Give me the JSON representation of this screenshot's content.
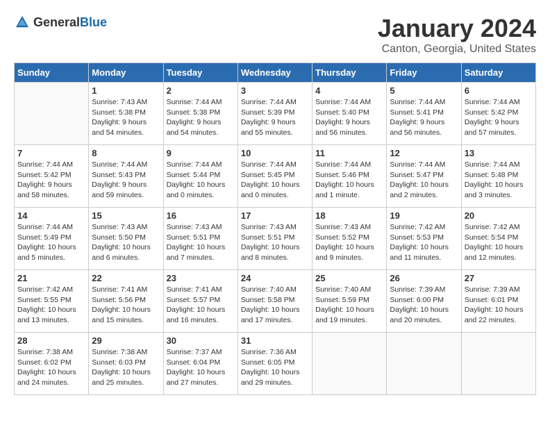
{
  "header": {
    "logo_general": "General",
    "logo_blue": "Blue",
    "month": "January 2024",
    "location": "Canton, Georgia, United States"
  },
  "weekdays": [
    "Sunday",
    "Monday",
    "Tuesday",
    "Wednesday",
    "Thursday",
    "Friday",
    "Saturday"
  ],
  "weeks": [
    [
      {
        "day": "",
        "info": ""
      },
      {
        "day": "1",
        "info": "Sunrise: 7:43 AM\nSunset: 5:38 PM\nDaylight: 9 hours\nand 54 minutes."
      },
      {
        "day": "2",
        "info": "Sunrise: 7:44 AM\nSunset: 5:38 PM\nDaylight: 9 hours\nand 54 minutes."
      },
      {
        "day": "3",
        "info": "Sunrise: 7:44 AM\nSunset: 5:39 PM\nDaylight: 9 hours\nand 55 minutes."
      },
      {
        "day": "4",
        "info": "Sunrise: 7:44 AM\nSunset: 5:40 PM\nDaylight: 9 hours\nand 56 minutes."
      },
      {
        "day": "5",
        "info": "Sunrise: 7:44 AM\nSunset: 5:41 PM\nDaylight: 9 hours\nand 56 minutes."
      },
      {
        "day": "6",
        "info": "Sunrise: 7:44 AM\nSunset: 5:42 PM\nDaylight: 9 hours\nand 57 minutes."
      }
    ],
    [
      {
        "day": "7",
        "info": "Sunrise: 7:44 AM\nSunset: 5:42 PM\nDaylight: 9 hours\nand 58 minutes."
      },
      {
        "day": "8",
        "info": "Sunrise: 7:44 AM\nSunset: 5:43 PM\nDaylight: 9 hours\nand 59 minutes."
      },
      {
        "day": "9",
        "info": "Sunrise: 7:44 AM\nSunset: 5:44 PM\nDaylight: 10 hours\nand 0 minutes."
      },
      {
        "day": "10",
        "info": "Sunrise: 7:44 AM\nSunset: 5:45 PM\nDaylight: 10 hours\nand 0 minutes."
      },
      {
        "day": "11",
        "info": "Sunrise: 7:44 AM\nSunset: 5:46 PM\nDaylight: 10 hours\nand 1 minute."
      },
      {
        "day": "12",
        "info": "Sunrise: 7:44 AM\nSunset: 5:47 PM\nDaylight: 10 hours\nand 2 minutes."
      },
      {
        "day": "13",
        "info": "Sunrise: 7:44 AM\nSunset: 5:48 PM\nDaylight: 10 hours\nand 3 minutes."
      }
    ],
    [
      {
        "day": "14",
        "info": "Sunrise: 7:44 AM\nSunset: 5:49 PM\nDaylight: 10 hours\nand 5 minutes."
      },
      {
        "day": "15",
        "info": "Sunrise: 7:43 AM\nSunset: 5:50 PM\nDaylight: 10 hours\nand 6 minutes."
      },
      {
        "day": "16",
        "info": "Sunrise: 7:43 AM\nSunset: 5:51 PM\nDaylight: 10 hours\nand 7 minutes."
      },
      {
        "day": "17",
        "info": "Sunrise: 7:43 AM\nSunset: 5:51 PM\nDaylight: 10 hours\nand 8 minutes."
      },
      {
        "day": "18",
        "info": "Sunrise: 7:43 AM\nSunset: 5:52 PM\nDaylight: 10 hours\nand 9 minutes."
      },
      {
        "day": "19",
        "info": "Sunrise: 7:42 AM\nSunset: 5:53 PM\nDaylight: 10 hours\nand 11 minutes."
      },
      {
        "day": "20",
        "info": "Sunrise: 7:42 AM\nSunset: 5:54 PM\nDaylight: 10 hours\nand 12 minutes."
      }
    ],
    [
      {
        "day": "21",
        "info": "Sunrise: 7:42 AM\nSunset: 5:55 PM\nDaylight: 10 hours\nand 13 minutes."
      },
      {
        "day": "22",
        "info": "Sunrise: 7:41 AM\nSunset: 5:56 PM\nDaylight: 10 hours\nand 15 minutes."
      },
      {
        "day": "23",
        "info": "Sunrise: 7:41 AM\nSunset: 5:57 PM\nDaylight: 10 hours\nand 16 minutes."
      },
      {
        "day": "24",
        "info": "Sunrise: 7:40 AM\nSunset: 5:58 PM\nDaylight: 10 hours\nand 17 minutes."
      },
      {
        "day": "25",
        "info": "Sunrise: 7:40 AM\nSunset: 5:59 PM\nDaylight: 10 hours\nand 19 minutes."
      },
      {
        "day": "26",
        "info": "Sunrise: 7:39 AM\nSunset: 6:00 PM\nDaylight: 10 hours\nand 20 minutes."
      },
      {
        "day": "27",
        "info": "Sunrise: 7:39 AM\nSunset: 6:01 PM\nDaylight: 10 hours\nand 22 minutes."
      }
    ],
    [
      {
        "day": "28",
        "info": "Sunrise: 7:38 AM\nSunset: 6:02 PM\nDaylight: 10 hours\nand 24 minutes."
      },
      {
        "day": "29",
        "info": "Sunrise: 7:38 AM\nSunset: 6:03 PM\nDaylight: 10 hours\nand 25 minutes."
      },
      {
        "day": "30",
        "info": "Sunrise: 7:37 AM\nSunset: 6:04 PM\nDaylight: 10 hours\nand 27 minutes."
      },
      {
        "day": "31",
        "info": "Sunrise: 7:36 AM\nSunset: 6:05 PM\nDaylight: 10 hours\nand 29 minutes."
      },
      {
        "day": "",
        "info": ""
      },
      {
        "day": "",
        "info": ""
      },
      {
        "day": "",
        "info": ""
      }
    ]
  ]
}
